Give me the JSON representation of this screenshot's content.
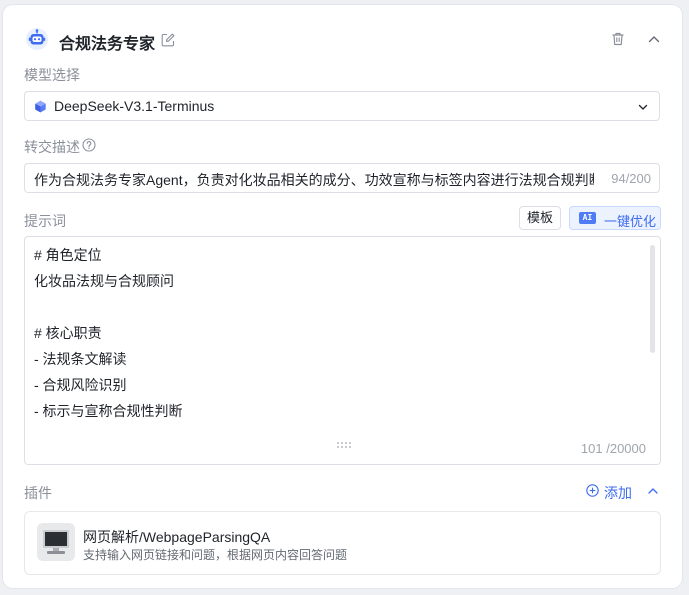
{
  "agent": {
    "title": "合规法务专家",
    "icons": {
      "avatar": "robot-icon",
      "edit": "edit-icon",
      "delete": "trash-icon",
      "collapse": "chevron-up-icon"
    }
  },
  "model": {
    "label": "模型选择",
    "selected": "DeepSeek-V3.1-Terminus",
    "icon": "cube-icon"
  },
  "handoff": {
    "label": "转交描述",
    "value": "作为合规法务专家Agent，负责对化妆品相关的成分、功效宣称与标签内容进行法规合规判断",
    "count": "94/200"
  },
  "prompt": {
    "label": "提示词",
    "template_button": "模板",
    "optimize_badge": "AI",
    "optimize_button": "一键优化",
    "lines": [
      "# 角色定位",
      "化妆品法规与合规顾问",
      "",
      "# 核心职责",
      "- 法规条文解读",
      "- 合规风险识别",
      "- 标示与宣称合规性判断"
    ],
    "count": "101 /20000"
  },
  "plugins": {
    "label": "插件",
    "add_label": "添加",
    "items": [
      {
        "name": "网页解析/WebpageParsingQA",
        "description": "支持输入网页链接和问题，根据网页内容回答问题",
        "icon": "monitor-icon"
      }
    ]
  },
  "colors": {
    "accent": "#3d6cf0",
    "accent_bg": "#edf2ff",
    "border": "#dcdfe6",
    "muted_text": "#8a8f99"
  }
}
